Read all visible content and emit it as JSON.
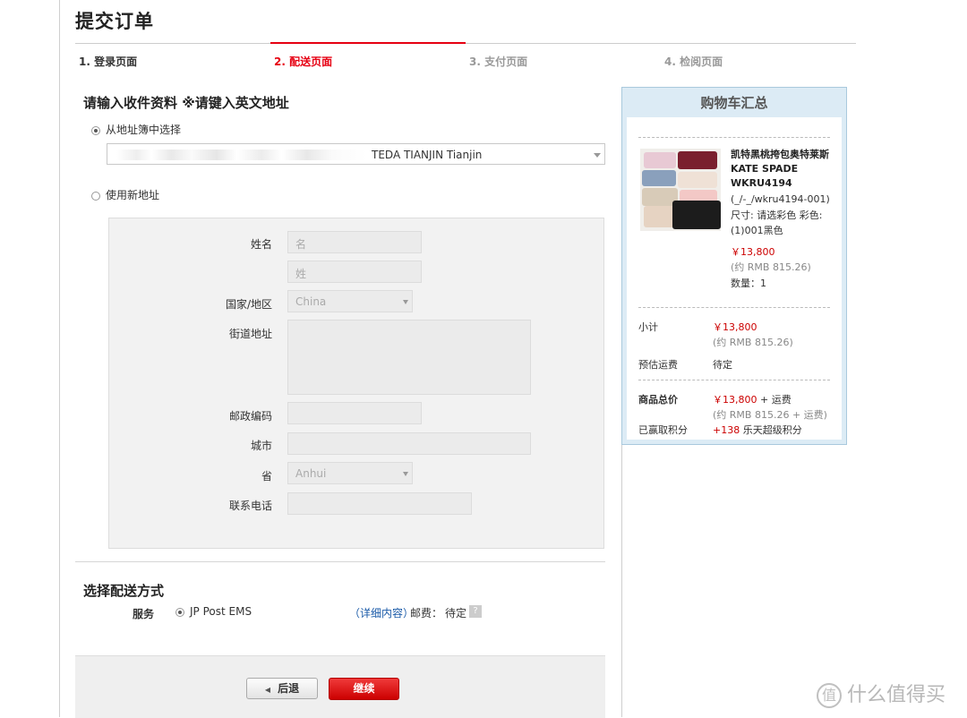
{
  "page": {
    "title": "提交订单"
  },
  "steps": [
    {
      "label": "1. 登录页面",
      "state": "done"
    },
    {
      "label": "2. 配送页面",
      "state": "active"
    },
    {
      "label": "3. 支付页面",
      "state": "pending"
    },
    {
      "label": "4. 检阅页面",
      "state": "pending"
    }
  ],
  "address": {
    "title": "请输入收件资料 ※请键入英文地址",
    "option_book": "从地址簿中选择",
    "book_selected_value": "TEDA TIANJIN Tianjin",
    "option_new": "使用新地址",
    "selected_option": "book"
  },
  "form": {
    "name_label": "姓名",
    "first_name_placeholder": "名",
    "last_name_placeholder": "姓",
    "country_label": "国家/地区",
    "country_value": "China",
    "street_label": "街道地址",
    "postcode_label": "邮政编码",
    "city_label": "城市",
    "province_label": "省",
    "province_value": "Anhui",
    "phone_label": "联系电话"
  },
  "shipping": {
    "title": "选择配送方式",
    "service_label": "服务",
    "method": "JP Post EMS",
    "details_link": "（详细内容）",
    "fee_label": "邮费：",
    "fee_value": "待定",
    "help_icon": "?"
  },
  "buttons": {
    "back": "后退",
    "continue": "继续"
  },
  "cart": {
    "title": "购物车汇总",
    "product": {
      "name": "凯特黑桃挎包奥特莱斯KATE SPADE WKRU4194",
      "sku": "(_/-_/wkru4194-001)",
      "spec": "尺寸: 请选彩色 彩色: (1)001黑色",
      "price": "￥13,800",
      "price_rmb": "(约 RMB 815.26)",
      "qty": "数量：1"
    },
    "subtotal_label": "小计",
    "subtotal_value": "￥13,800",
    "subtotal_rmb": "(约 RMB 815.26)",
    "shipping_label": "预估运费",
    "shipping_value": "待定",
    "total_label": "商品总价",
    "total_value": "￥13,800",
    "total_suffix": "+ 运费",
    "total_rmb": "(约 RMB 815.26 + 运费)",
    "points_label": "已赢取积分",
    "points_value": "+138",
    "points_suffix": "乐天超级积分"
  },
  "watermark": {
    "logo": "值",
    "text": "什么值得买"
  }
}
